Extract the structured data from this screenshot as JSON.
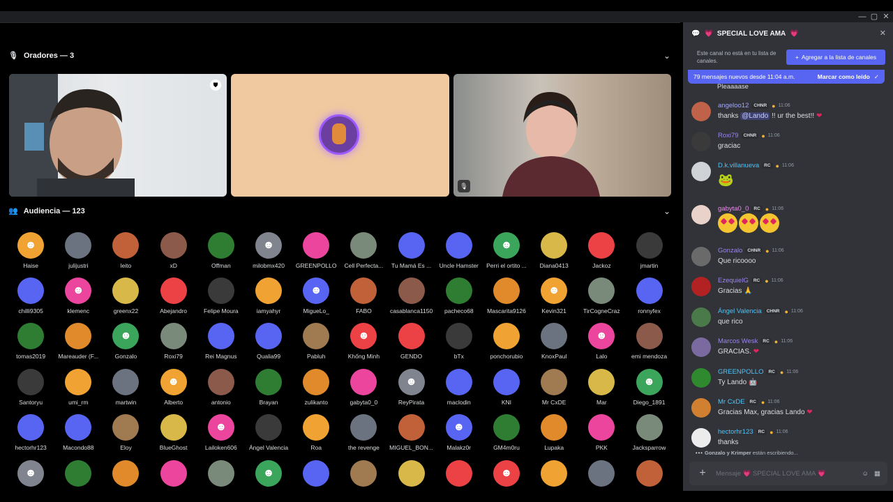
{
  "window": {
    "minimize": "—",
    "maximize": "▢",
    "close": "✕"
  },
  "speakers": {
    "label": "Oradores — 3"
  },
  "audience": {
    "label": "Audiencia — 123"
  },
  "audience_members": [
    [
      "Haise",
      "julijustri",
      "leito",
      "xD",
      "Offman",
      "milobmx420",
      "GREENPOLLO",
      "Cell Perfecta...",
      "Tu Mamá Es ...",
      "Uncle Hamster",
      "Perri el ortito ...",
      "Diana0413",
      "Jackoz",
      "jmartin"
    ],
    [
      "chilli9305",
      "klemenc",
      "greenx22",
      "Abejandro",
      "Felipe Moura",
      "iamyahyr",
      "MigueLo_",
      "FABO",
      "casablanca1150",
      "pacheco68",
      "Mascarita9126",
      "Kevin321",
      "TirCogneCraz",
      "ronnyfex"
    ],
    [
      "tomas2019",
      "Mareauder (F...",
      "Gonzalo",
      "Roxi79",
      "Rei Magnus",
      "Qualia99",
      "Pabluh",
      "Khống Minh",
      "GENDO",
      "bTx",
      "ponchorubio",
      "KnoxPaul",
      "Lalo",
      "emi mendoza"
    ],
    [
      "Santoryu",
      "umi_rm",
      "martwin",
      "Alberto",
      "antonio",
      "Brayan",
      "zulikanto",
      "gabyta0_0",
      "ReyPirata",
      "maclodin",
      "KNI",
      "Mr CxDE",
      "Mar",
      "Diego_1891"
    ],
    [
      "hectorhr123",
      "Macondo88",
      "Eloy",
      "BlueGhost",
      "Lailoken606",
      "Ángel Valencia",
      "Roa",
      "the revenge",
      "MIGUEL_BON...",
      "Malakz0r",
      "GM4m0ru",
      "Lupaka",
      "PKK",
      "Jacksparrow"
    ],
    [
      "",
      "",
      "",
      "",
      "",
      "",
      "",
      "",
      "",
      "",
      "",
      "",
      "",
      ""
    ]
  ],
  "chat": {
    "title": "SPECIAL LOVE AMA",
    "notice": "Este canal no está en tu lista de canales.",
    "add_button": "Agregar a la lista de canales",
    "new_messages": "79 mensajes nuevos desde 11:04 a.m.",
    "mark_read": "Marcar como leído",
    "prev_text": "Pleaaaase",
    "messages": [
      {
        "user": "angeloo12",
        "badge": "CHNR",
        "time": "11:06",
        "text_before": "thanks",
        "mention": "@Lando",
        "text_after": "!! ur the best!!",
        "color": "#a0a6ff"
      },
      {
        "user": "Roxi79",
        "badge": "CHNR",
        "time": "11:06",
        "text": "graciac",
        "color": "#9b84ee"
      },
      {
        "user": "D.k.villanueva",
        "badge": "RC",
        "time": "11:06",
        "text": "",
        "color": "#4fc3f7"
      },
      {
        "user": "gabyta0_0",
        "badge": "RC",
        "time": "11:06",
        "text": "",
        "color": "#e78be8"
      },
      {
        "user": "Gonzalo",
        "badge": "CHNR",
        "time": "11:06",
        "text": "Que ricoooo",
        "color": "#9b84ee"
      },
      {
        "user": "EzequielG",
        "badge": "RC",
        "time": "11:06",
        "text": "Gracias",
        "color": "#9b84ee"
      },
      {
        "user": "Ángel Valencia",
        "badge": "CHNR",
        "time": "11:06",
        "text": "que rico",
        "color": "#4fc3f7"
      },
      {
        "user": "Marcos Wesk",
        "badge": "RC",
        "time": "11:06",
        "text": "GRACIAS.",
        "color": "#9b84ee"
      },
      {
        "user": "GREENPOLLO",
        "badge": "RC",
        "time": "11:06",
        "text": "Ty Lando",
        "color": "#4fc3f7"
      },
      {
        "user": "Mr CxDE",
        "badge": "RC",
        "time": "11:06",
        "text": "Gracias Max, gracias Lando",
        "color": "#4fc3f7"
      },
      {
        "user": "hectorhr123",
        "badge": "RC",
        "time": "11:06",
        "text": "thanks",
        "color": "#4fc3f7"
      }
    ],
    "typing": {
      "names": "Gonzalo y Krimper",
      "suffix": "están escribiendo..."
    },
    "input_placeholder": "Mensaje 💗 SPECIAL LOVE AMA 💗"
  }
}
